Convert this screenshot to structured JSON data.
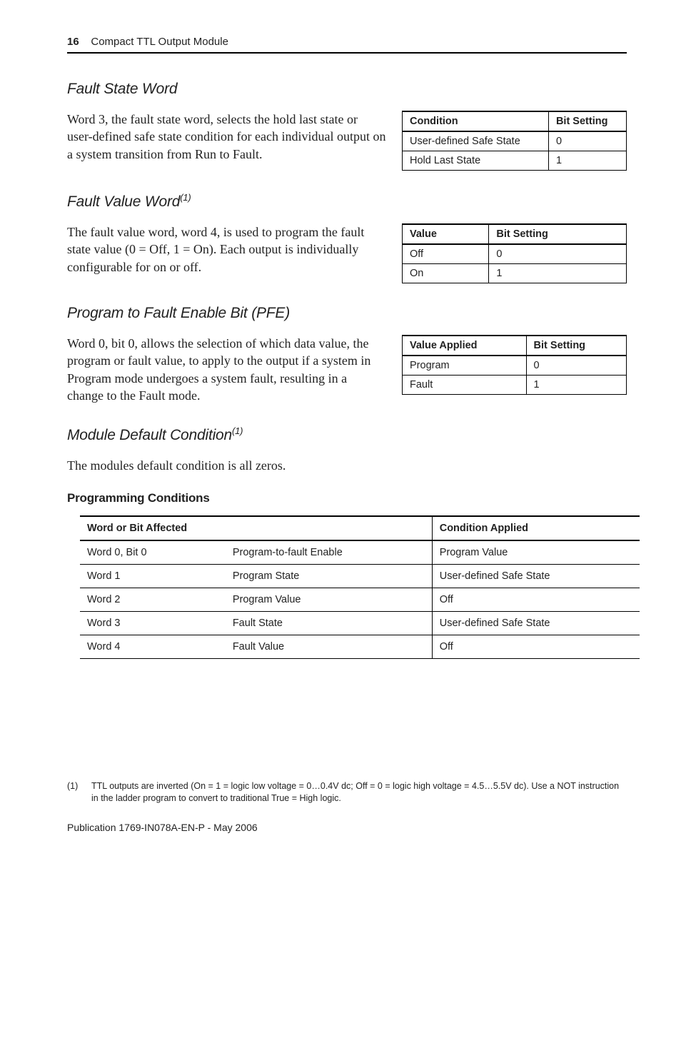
{
  "header": {
    "page_number": "16",
    "title": "Compact TTL Output Module"
  },
  "sections": {
    "fault_state_word": {
      "heading": "Fault State Word",
      "body": "Word 3, the fault state word, selects the hold last state or user-defined safe state condition for each individual output on a system transition from Run to Fault.",
      "table": {
        "headers": [
          "Condition",
          "Bit Setting"
        ],
        "rows": [
          [
            "User-defined Safe State",
            "0"
          ],
          [
            "Hold Last State",
            "1"
          ]
        ]
      }
    },
    "fault_value_word": {
      "heading": "Fault Value Word",
      "heading_sup": "(1)",
      "body": "The fault value word, word 4, is used to program the fault state value (0 = Off, 1 = On). Each output is individually configurable for on or off.",
      "table": {
        "headers": [
          "Value",
          "Bit Setting"
        ],
        "rows": [
          [
            "Off",
            "0"
          ],
          [
            "On",
            "1"
          ]
        ]
      }
    },
    "pfe": {
      "heading": "Program to Fault Enable Bit (PFE)",
      "body": "Word 0, bit 0, allows the selection of which data value, the program or fault value, to apply to the output if a system in Program mode undergoes a system fault, resulting in a change to the Fault mode.",
      "table": {
        "headers": [
          "Value Applied",
          "Bit Setting"
        ],
        "rows": [
          [
            "Program",
            "0"
          ],
          [
            "Fault",
            "1"
          ]
        ]
      }
    },
    "module_default": {
      "heading": "Module Default Condition",
      "heading_sup": "(1)",
      "body": "The modules default condition is all zeros."
    },
    "programming_conditions": {
      "heading": "Programming Conditions",
      "table": {
        "header_left": "Word or Bit Affected",
        "header_right": "Condition Applied",
        "rows": [
          [
            "Word 0, Bit 0",
            "Program-to-fault Enable",
            "Program Value"
          ],
          [
            "Word 1",
            "Program State",
            "User-defined Safe State"
          ],
          [
            "Word 2",
            "Program Value",
            "Off"
          ],
          [
            "Word 3",
            "Fault State",
            "User-defined Safe State"
          ],
          [
            "Word 4",
            "Fault Value",
            "Off"
          ]
        ]
      }
    }
  },
  "footnote": {
    "mark": "(1)",
    "text": "TTL outputs are inverted (On = 1 = logic low voltage = 0…0.4V dc; Off = 0 = logic high voltage = 4.5…5.5V dc). Use a NOT instruction in the ladder program to convert to traditional True = High logic."
  },
  "footer": {
    "publication": "Publication 1769-IN078A-EN-P - May 2006"
  }
}
